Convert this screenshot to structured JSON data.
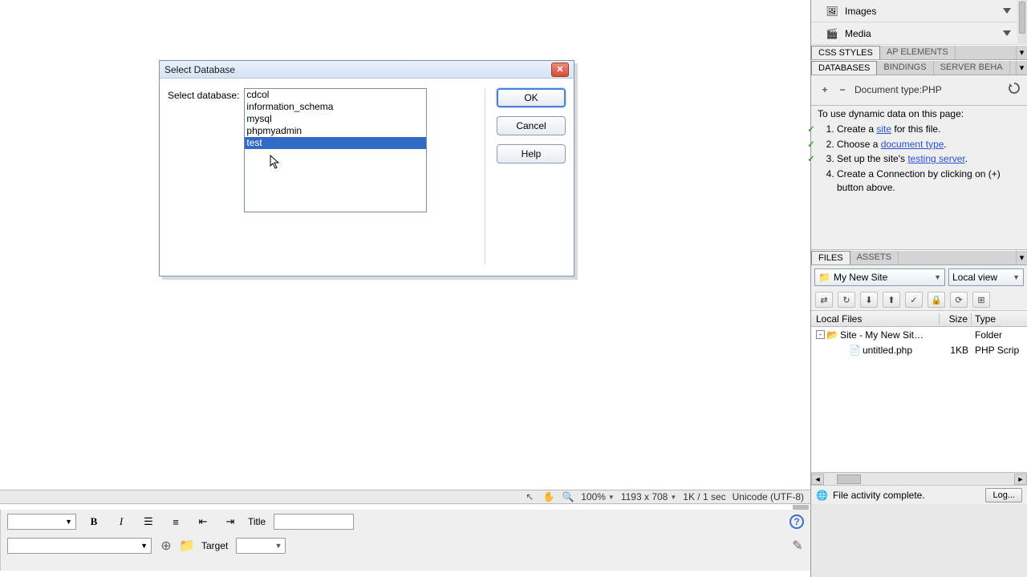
{
  "dialog": {
    "title": "Select Database",
    "label": "Select database:",
    "items": [
      "cdcol",
      "information_schema",
      "mysql",
      "phpmyadmin",
      "test"
    ],
    "selected_index": 4,
    "buttons": {
      "ok": "OK",
      "cancel": "Cancel",
      "help": "Help"
    }
  },
  "assets": {
    "rows": [
      {
        "icon": "images-icon",
        "label": "Images"
      },
      {
        "icon": "media-icon",
        "label": "Media"
      }
    ]
  },
  "panel_tabs": {
    "row1": [
      "CSS STYLES",
      "AP ELEMENTS"
    ],
    "row1_active": 0,
    "row2": [
      "DATABASES",
      "BINDINGS",
      "SERVER BEHA"
    ],
    "row2_active": 0
  },
  "db_panel": {
    "doc_type": "Document type:PHP",
    "intro": "To use dynamic data on this page:",
    "steps": [
      {
        "done": true,
        "pre": "Create a ",
        "link": "site",
        "post": " for this file."
      },
      {
        "done": true,
        "pre": "Choose a ",
        "link": "document type",
        "post": "."
      },
      {
        "done": true,
        "pre": "Set up the site's ",
        "link": "testing server",
        "post": "."
      },
      {
        "done": false,
        "pre": "Create a Connection by clicking on (+) button above.",
        "link": "",
        "post": ""
      }
    ]
  },
  "files_tabs": [
    "FILES",
    "ASSETS"
  ],
  "files_tabs_active": 0,
  "files": {
    "site_combo": "My New Site",
    "view_combo": "Local view",
    "header": {
      "c1": "Local Files",
      "c2": "Size",
      "c3": "Type"
    },
    "rows": [
      {
        "indent": 0,
        "exp": "-",
        "icon": "folder",
        "name": "Site - My New Sit…",
        "size": "",
        "type": "Folder"
      },
      {
        "indent": 1,
        "exp": "",
        "icon": "file",
        "name": "untitled.php",
        "size": "1KB",
        "type": "PHP Scrip"
      }
    ],
    "status": "File activity complete.",
    "log_btn": "Log..."
  },
  "statusbar": {
    "zoom": "100%",
    "dims": "1193 x 708",
    "perf": "1K / 1 sec",
    "enc": "Unicode (UTF-8)"
  },
  "props": {
    "title_label": "Title",
    "target_label": "Target"
  }
}
